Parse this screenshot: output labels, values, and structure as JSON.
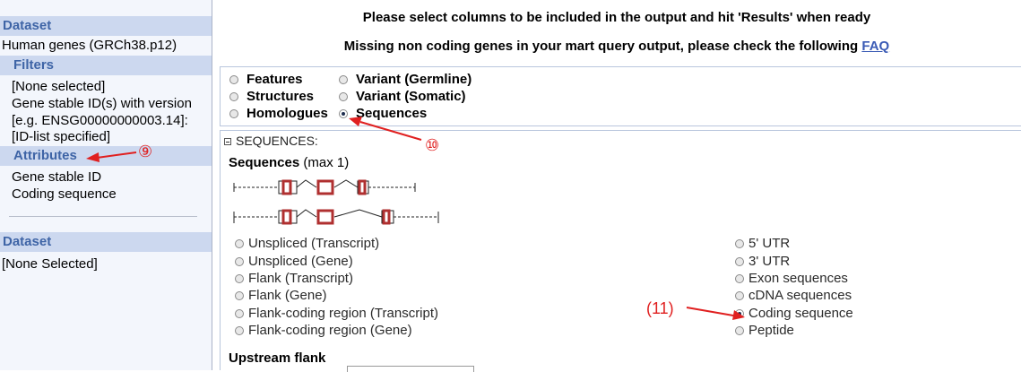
{
  "sidebar": {
    "dataset_header": "Dataset",
    "dataset_value": "Human genes (GRCh38.p12)",
    "filters_header": "Filters",
    "filters_lines": [
      "[None selected]",
      "Gene stable ID(s) with version",
      "[e.g. ENSG00000000003.14]:",
      "[ID-list specified]"
    ],
    "attributes_header": "Attributes",
    "attributes_lines": [
      "Gene stable ID",
      "Coding sequence"
    ],
    "dataset2_header": "Dataset",
    "dataset2_value": "[None Selected]"
  },
  "main": {
    "message_line1": "Please select columns to be included in the output and hit 'Results' when ready",
    "message_line2": "Missing non coding genes in your mart query output, please check the following",
    "faq_link": "FAQ",
    "attribute_pages": [
      {
        "label": "Features",
        "selected": false
      },
      {
        "label": "Variant (Germline)",
        "selected": false
      },
      {
        "label": "Structures",
        "selected": false
      },
      {
        "label": "Variant (Somatic)",
        "selected": false
      },
      {
        "label": "Homologues",
        "selected": false
      },
      {
        "label": "Sequences",
        "selected": true
      }
    ],
    "section_title": "SEQUENCES:",
    "sequences_label": "Sequences",
    "sequences_max": "(max 1)",
    "options_left": [
      "Unspliced (Transcript)",
      "Unspliced (Gene)",
      "Flank (Transcript)",
      "Flank (Gene)",
      "Flank-coding region (Transcript)",
      "Flank-coding region (Gene)"
    ],
    "options_right": [
      "5' UTR",
      "3' UTR",
      "Exon sequences",
      "cDNA sequences",
      "Coding sequence",
      "Peptide"
    ],
    "selected_option": "Coding sequence",
    "upstream_label": "Upstream flank"
  },
  "annotations": {
    "a9": "⑨",
    "a10": "⑩",
    "a11": "(11)",
    "color": "#e02020"
  }
}
